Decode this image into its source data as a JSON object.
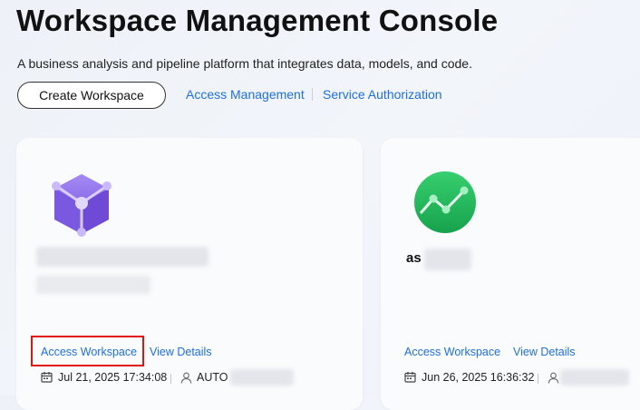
{
  "header": {
    "title": "Workspace Management Console",
    "subtitle": "A business analysis and pipeline platform that integrates data, models, and code."
  },
  "actions": {
    "create_label": "Create Workspace",
    "access_management": "Access Management",
    "service_authorization": "Service Authorization"
  },
  "workspaces": [
    {
      "icon": "cube-icon",
      "access_label": "Access Workspace",
      "details_label": "View Details",
      "created": "Jul 21, 2025 17:34:08",
      "owner_prefix": "AUTO"
    },
    {
      "icon": "trend-chart-icon",
      "name_prefix": "as",
      "access_label": "Access Workspace",
      "details_label": "View Details",
      "created": "Jun 26, 2025 16:36:32"
    }
  ],
  "colors": {
    "link": "#1f6fe0",
    "highlight": "#e3140f",
    "cube": "#7b58e0",
    "chart": "#22b45a"
  }
}
